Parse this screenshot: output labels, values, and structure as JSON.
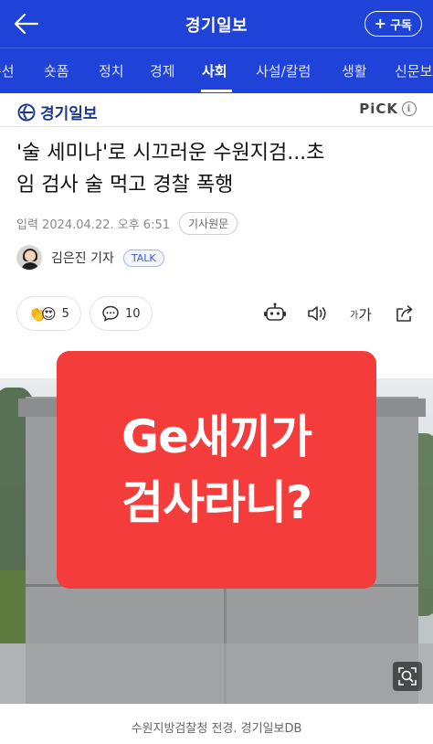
{
  "header": {
    "brand": "경기일보",
    "subscribe_label": "구독",
    "subscribe_icon": "plus-icon",
    "back_icon": "arrow-left-icon",
    "background_color": "#1f43d8"
  },
  "nav": {
    "tabs": [
      {
        "label": "총선"
      },
      {
        "label": "숏폼"
      },
      {
        "label": "정치"
      },
      {
        "label": "경제"
      },
      {
        "label": "사회",
        "active": true
      },
      {
        "label": "사설/칼럼"
      },
      {
        "label": "생활"
      },
      {
        "label": "신문보"
      }
    ]
  },
  "publisher": {
    "logo_text": "경기일보",
    "pick_label": "PiCK",
    "info_icon": "info-icon"
  },
  "article": {
    "headline_line1": "'술 세미나'로 시끄러운 수원지검...초",
    "headline_line2": "임 검사 술 먹고 경찰 폭행",
    "date": "입력 2024.04.22. 오후 6:51",
    "source_button": "기사원문",
    "author": "김은진 기자",
    "talk_badge": "TALK"
  },
  "actions": {
    "reaction_count": "5",
    "comment_count": "10",
    "font_small": "가",
    "font_large": "가",
    "icons": [
      "clap-emoji-icon",
      "comment-icon",
      "robot-summary-icon",
      "speaker-icon",
      "font-size-icon",
      "share-icon"
    ]
  },
  "overlay": {
    "line1": "Ge새끼가",
    "line2": "검사라니?",
    "color": "#f43c3a"
  },
  "photo": {
    "zoom_icon": "zoom-icon",
    "caption": "수원지방검찰청 전경. 경기일보DB"
  }
}
